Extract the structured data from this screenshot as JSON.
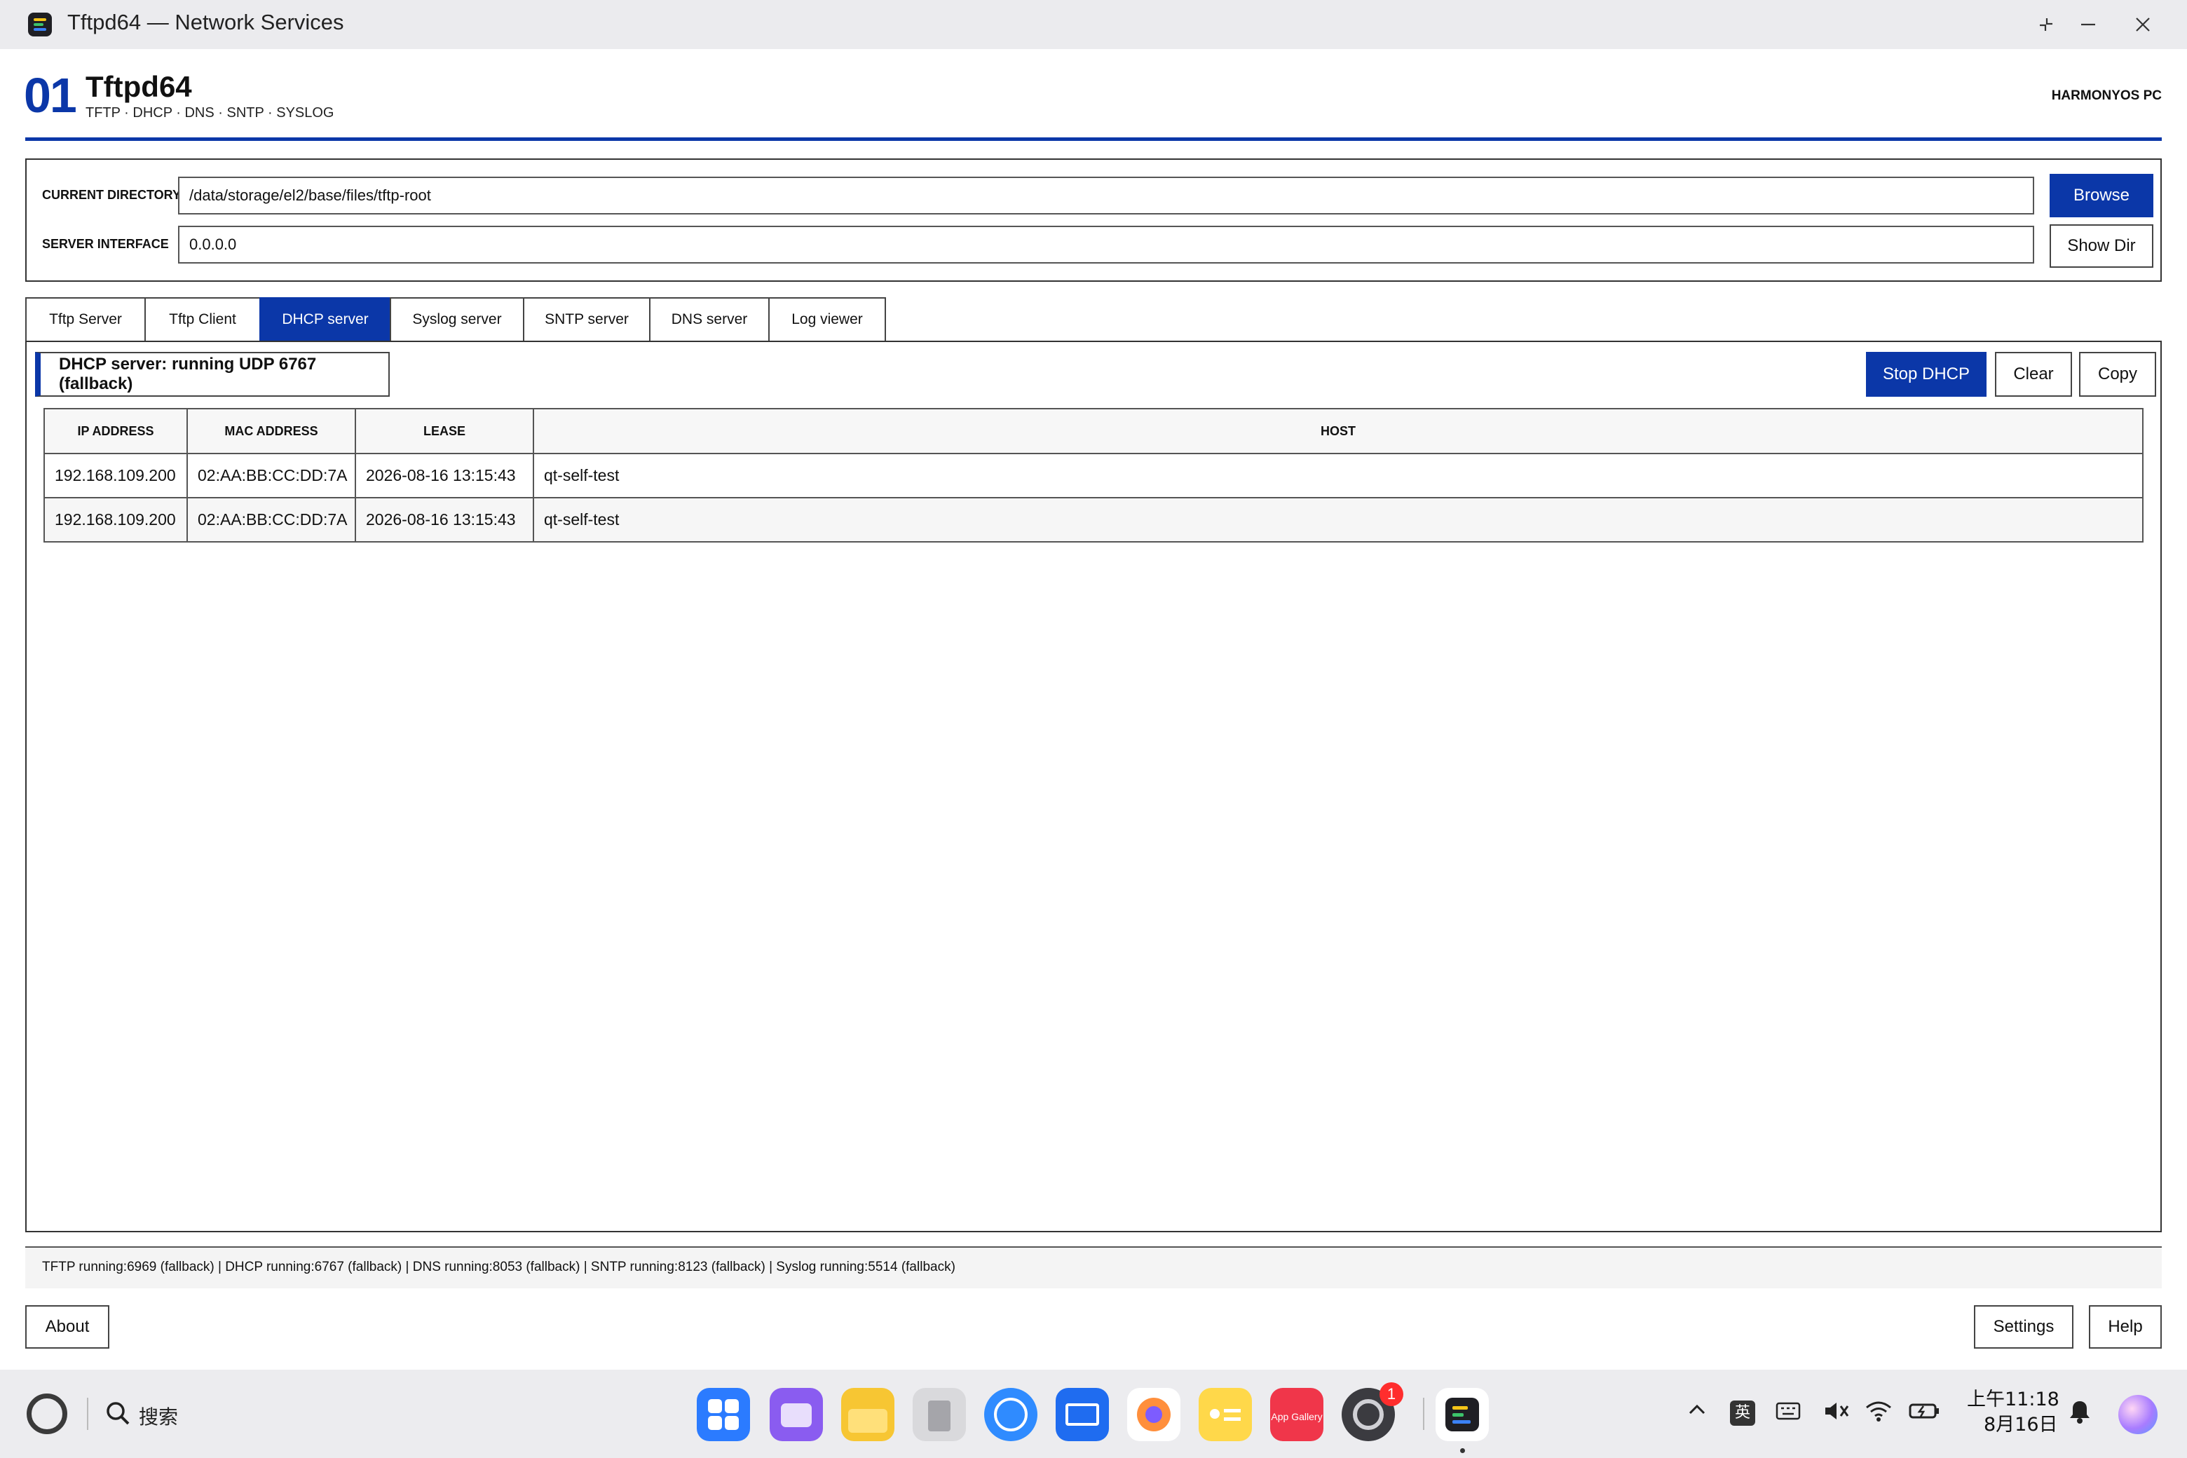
{
  "window": {
    "title": "Tftpd64 — Network Services"
  },
  "header": {
    "number": "01",
    "app_name": "Tftpd64",
    "subtitle": "TFTP · DHCP · DNS · SNTP · SYSLOG",
    "platform": "HARMONYOS PC"
  },
  "settings": {
    "dir_label": "CURRENT DIRECTORY",
    "dir_value": "/data/storage/el2/base/files/tftp-root",
    "iface_label": "SERVER INTERFACE",
    "iface_value": "0.0.0.0",
    "browse_label": "Browse",
    "showdir_label": "Show Dir"
  },
  "tabs": [
    {
      "label": "Tftp Server"
    },
    {
      "label": "Tftp Client"
    },
    {
      "label": "DHCP server"
    },
    {
      "label": "Syslog server"
    },
    {
      "label": "SNTP server"
    },
    {
      "label": "DNS server"
    },
    {
      "label": "Log viewer"
    }
  ],
  "dhcp": {
    "status": "DHCP server: running  UDP 6767 (fallback)",
    "stop_label": "Stop DHCP",
    "clear_label": "Clear",
    "copy_label": "Copy",
    "columns": [
      "IP ADDRESS",
      "MAC ADDRESS",
      "LEASE",
      "HOST"
    ],
    "rows": [
      {
        "ip": "192.168.109.200",
        "mac": "02:AA:BB:CC:DD:7A",
        "lease": "2026-08-16 13:15:43",
        "host": "qt-self-test"
      },
      {
        "ip": "192.168.109.200",
        "mac": "02:AA:BB:CC:DD:7A",
        "lease": "2026-08-16 13:15:43",
        "host": "qt-self-test"
      }
    ]
  },
  "statusbar": {
    "text": "TFTP running:6969 (fallback) | DHCP running:6767 (fallback) | DNS running:8053 (fallback) | SNTP running:8123 (fallback) | Syslog running:5514 (fallback)"
  },
  "footer": {
    "about_label": "About",
    "settings_label": "Settings",
    "help_label": "Help"
  },
  "taskbar": {
    "search_label": "搜索",
    "app_gallery_label": "App Gallery",
    "settings_badge": "1",
    "ime_label": "英",
    "time": "上午11:18",
    "date": "8月16日"
  },
  "colors": {
    "accent": "#0b37a8"
  }
}
